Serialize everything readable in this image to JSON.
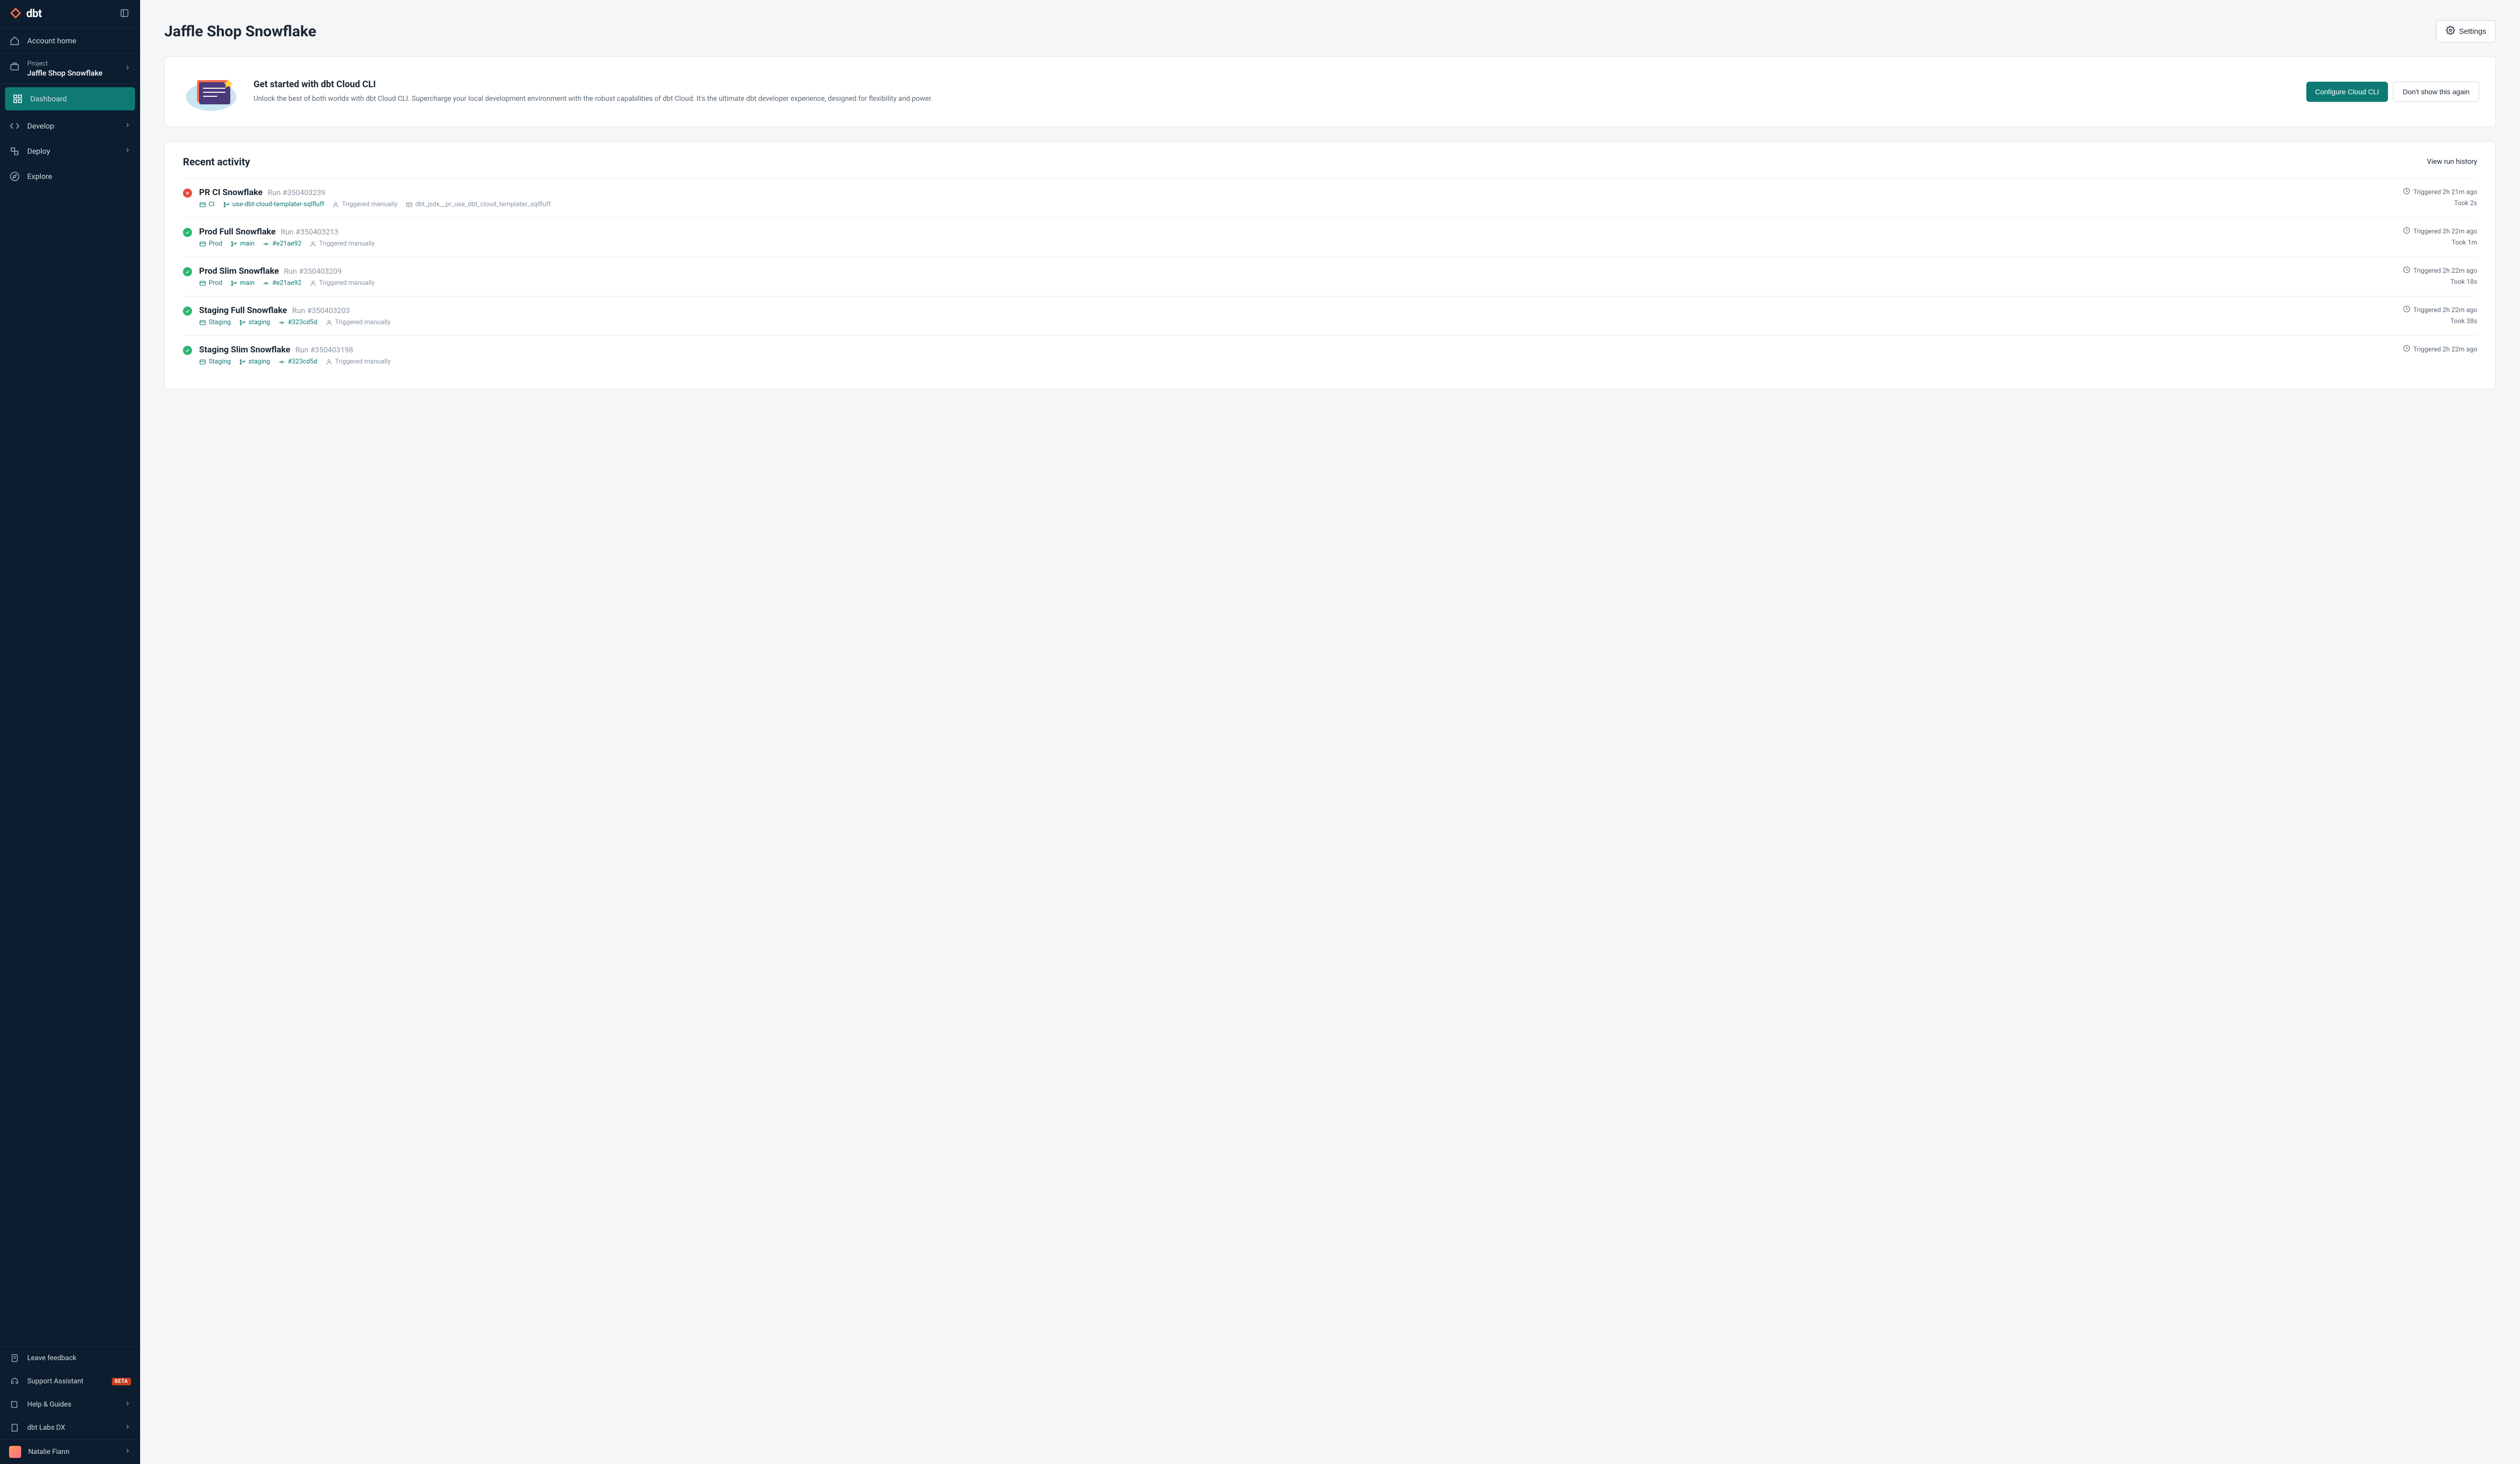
{
  "brand": "dbt",
  "sidebar": {
    "account_home": "Account home",
    "project_label": "Project",
    "project_name": "Jaffle Shop Snowflake",
    "nav": {
      "dashboard": "Dashboard",
      "develop": "Develop",
      "deploy": "Deploy",
      "explore": "Explore"
    },
    "footer": {
      "feedback": "Leave feedback",
      "support": "Support Assistant",
      "support_badge": "BETA",
      "help": "Help & Guides",
      "org": "dbt Labs DX"
    },
    "user": "Natalie Fiann"
  },
  "page": {
    "title": "Jaffle Shop Snowflake",
    "settings": "Settings"
  },
  "promo": {
    "title": "Get started with dbt Cloud CLI",
    "desc": "Unlock the best of both worlds with dbt Cloud CLI. Supercharge your local development environment with the robust capabilities of dbt Cloud. It's the ultimate dbt developer experience, designed for flexibility and power.",
    "primary": "Configure Cloud CLI",
    "secondary": "Don't show this again"
  },
  "activity": {
    "title": "Recent activity",
    "link": "View run history",
    "runs": [
      {
        "status": "fail",
        "name": "PR CI Snowflake",
        "run_id": "Run #350403239",
        "env": "CI",
        "branch": "use-dbt-cloud-templater-sqlfluff",
        "commit": "",
        "trigger": "Triggered manually",
        "schema": "dbt_jsdx__pr_use_dbt_cloud_templater_sqlfluff",
        "triggered": "Triggered 2h 21m ago",
        "duration": "Took 2s"
      },
      {
        "status": "success",
        "name": "Prod Full Snowflake",
        "run_id": "Run #350403213",
        "env": "Prod",
        "branch": "main",
        "commit": "#e21ae92",
        "trigger": "Triggered manually",
        "schema": "",
        "triggered": "Triggered 2h 22m ago",
        "duration": "Took 1m"
      },
      {
        "status": "success",
        "name": "Prod Slim Snowflake",
        "run_id": "Run #350403209",
        "env": "Prod",
        "branch": "main",
        "commit": "#e21ae92",
        "trigger": "Triggered manually",
        "schema": "",
        "triggered": "Triggered 2h 22m ago",
        "duration": "Took 18s"
      },
      {
        "status": "success",
        "name": "Staging Full Snowflake",
        "run_id": "Run #350403203",
        "env": "Staging",
        "branch": "staging",
        "commit": "#323cd5d",
        "trigger": "Triggered manually",
        "schema": "",
        "triggered": "Triggered 2h 22m ago",
        "duration": "Took 38s"
      },
      {
        "status": "success",
        "name": "Staging Slim Snowflake",
        "run_id": "Run #350403198",
        "env": "Staging",
        "branch": "staging",
        "commit": "#323cd5d",
        "trigger": "Triggered manually",
        "schema": "",
        "triggered": "Triggered 2h 22m ago",
        "duration": ""
      }
    ]
  }
}
